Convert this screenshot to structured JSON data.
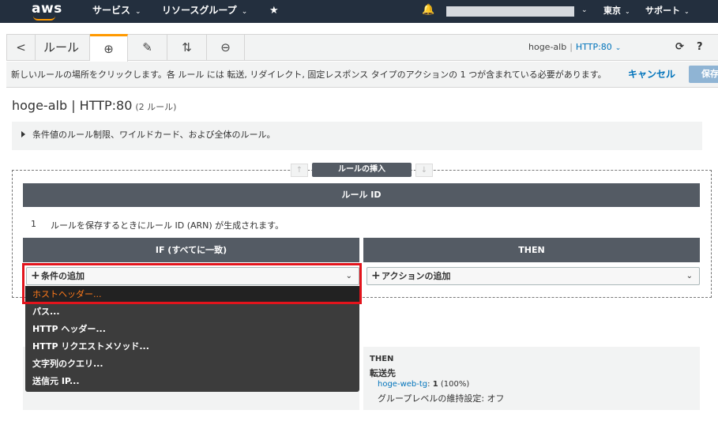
{
  "nav": {
    "logo": "aws",
    "services": "サービス",
    "resource_groups": "リソースグループ",
    "region": "東京",
    "support": "サポート"
  },
  "toolbar": {
    "back": "<",
    "title": "ルール",
    "lb_name": "hoge-alb",
    "separator": "|",
    "listener": "HTTP:80"
  },
  "infobar": {
    "message": "新しいルールの場所をクリックします。各 ルール には 転送, リダイレクト, 固定レスポンス タイプのアクションの 1 つが含まれている必要があります。",
    "cancel": "キャンセル",
    "save": "保存"
  },
  "page": {
    "title": "hoge-alb | HTTP:80",
    "rule_count": "(2 ルール)",
    "note": "条件値のルール制限、ワイルドカード、および全体のルール。"
  },
  "insert": {
    "label": "ルールの挿入",
    "up": "↑",
    "down": "↓"
  },
  "rule": {
    "id_header": "ルール ID",
    "number": "1",
    "id_note": "ルールを保存するときにルール ID (ARN) が生成されます。",
    "if_header": "IF (すべてに一致)",
    "then_header": "THEN",
    "add_condition": "条件の追加",
    "add_action": "アクションの追加"
  },
  "dropdown": {
    "items": [
      "ホストヘッダー...",
      "パス...",
      "HTTP ヘッダー...",
      "HTTP リクエストメソッド...",
      "文字列のクエリ...",
      "送信元 IP..."
    ],
    "highlighted_index": 0
  },
  "existing_rule": {
    "then": "THEN",
    "forward": "転送先",
    "target_group": "hoge-web-tg",
    "weight_sep": ":",
    "weight": "1",
    "percent": "(100%)",
    "stickiness": "グループレベルの維持設定: オフ"
  },
  "colors": {
    "nav_bg": "#232f3e",
    "accent": "#ff9900",
    "link": "#0073bb",
    "header_bg": "#545b64",
    "highlight_frame": "#e3141c",
    "highlight_text": "#ff7a1a"
  }
}
